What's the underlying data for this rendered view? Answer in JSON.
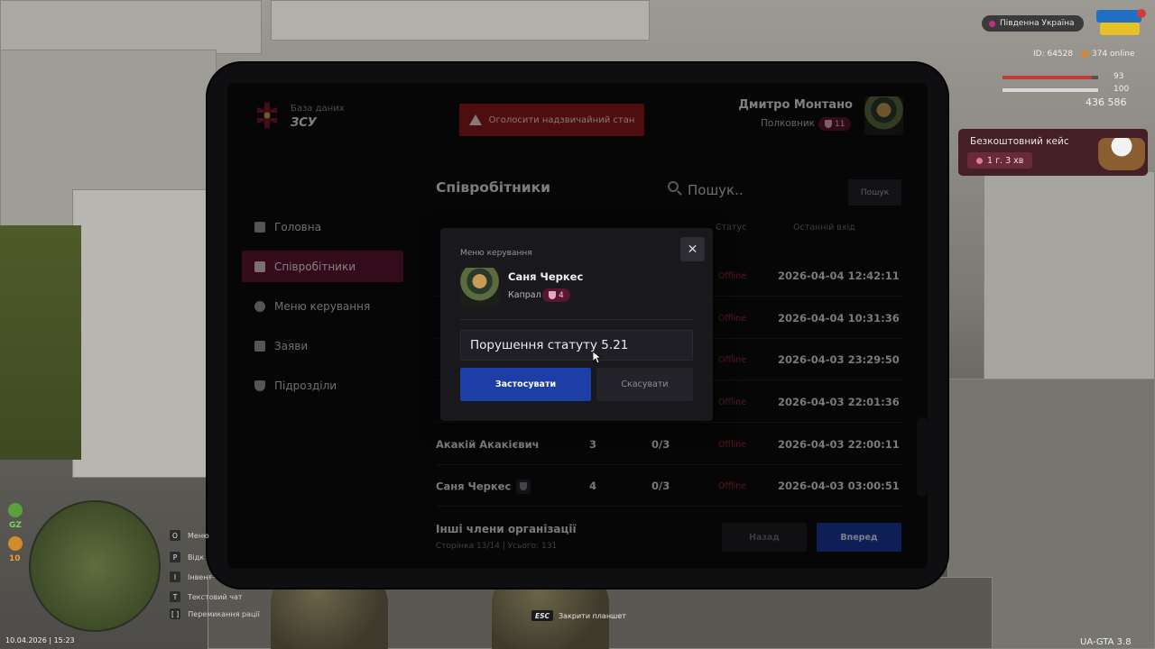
{
  "header": {
    "db_label": "База даних",
    "org_name": "ЗСУ",
    "emergency_button": "Оголосити надзвичайний стан",
    "user": {
      "name": "Дмитро Монтано",
      "rank": "Полковник",
      "rank_level": "11"
    }
  },
  "sidebar": {
    "items": [
      {
        "label": "Головна",
        "icon": "home-icon",
        "active": false
      },
      {
        "label": "Співробітники",
        "icon": "users-icon",
        "active": true
      },
      {
        "label": "Меню керування",
        "icon": "gear-icon",
        "active": false
      },
      {
        "label": "Заяви",
        "icon": "folder-icon",
        "active": false
      },
      {
        "label": "Підрозділи",
        "icon": "shield-icon",
        "active": false
      }
    ]
  },
  "main": {
    "title": "Співробітники",
    "search": {
      "placeholder": "Пошук..",
      "button": "Пошук"
    },
    "columns": {
      "status": "Статус",
      "last_login": "Останній вхід"
    },
    "rows": [
      {
        "name": "",
        "rank": "",
        "warnings": "",
        "status": "Offline",
        "last_login": "2026-04-04 12:42:11"
      },
      {
        "name": "",
        "rank": "",
        "warnings": "",
        "status": "Offline",
        "last_login": "2026-04-04 10:31:36"
      },
      {
        "name": "",
        "rank": "",
        "warnings": "",
        "status": "Offline",
        "last_login": "2026-04-03 23:29:50"
      },
      {
        "name": "",
        "rank": "",
        "warnings": "",
        "status": "Offline",
        "last_login": "2026-04-03 22:01:36"
      },
      {
        "name": "Акакій Акакієвич",
        "rank": "3",
        "warnings": "0/3",
        "status": "Offline",
        "last_login": "2026-04-03 22:00:11"
      },
      {
        "name": "Саня Черкес",
        "rank": "4",
        "warnings": "0/3",
        "status": "Offline",
        "last_login": "2026-04-03 03:00:51"
      }
    ],
    "footer": {
      "title": "Інші члени організації",
      "subtitle": "Сторінка 13/14 | Усього: 131",
      "back": "Назад",
      "next": "Вперед"
    }
  },
  "modal": {
    "title": "Меню керування",
    "member_name": "Саня Черкес",
    "member_rank": "Капрал",
    "member_rank_level": "4",
    "reason_value": "Порушення статуту 5.21",
    "apply": "Застосувати",
    "cancel": "Скасувати"
  },
  "hud": {
    "region": "Південна Україна",
    "player_id": "ID: 64528",
    "online": "374 online",
    "health": "93",
    "armor": "100",
    "money": "436 586",
    "case_title": "Безкоштовний кейс",
    "case_timer": "1 г. 3 хв",
    "gz": "GZ",
    "level": "10",
    "datetime": "10.04.2026 | 15:23",
    "version": "UA-GTA 3.8",
    "esc_key": "ESC",
    "esc_label": "Закрити планшет",
    "hints": [
      {
        "key": "O",
        "label": "Меню"
      },
      {
        "key": "P",
        "label": "Відк"
      },
      {
        "key": "I",
        "label": "Інвент"
      },
      {
        "key": "T",
        "label": "Текстовий чат"
      },
      {
        "key": "[ ]",
        "label": "Перемикання рації"
      }
    ]
  },
  "colors": {
    "accent_active": "#5e1430",
    "primary_blue": "#1c3ea6",
    "danger_red": "#8e1a1e",
    "offline": "#9a2a36"
  }
}
